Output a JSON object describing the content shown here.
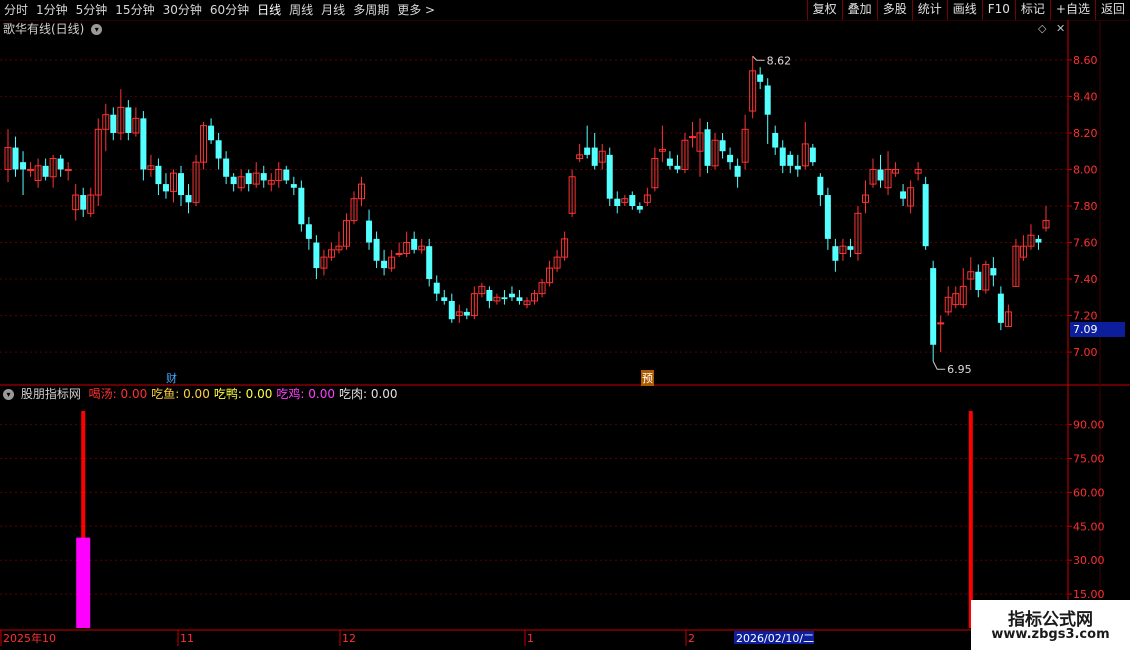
{
  "toolbar": {
    "periods": [
      "分时",
      "1分钟",
      "5分钟",
      "15分钟",
      "30分钟",
      "60分钟",
      "日线",
      "周线",
      "月线",
      "多周期"
    ],
    "active_period": "日线",
    "more_label": "更多",
    "buttons": [
      "复权",
      "叠加",
      "多股",
      "统计",
      "画线",
      "F10",
      "标记",
      "+自选",
      "返回"
    ]
  },
  "main_panel": {
    "title": "歌华有线(日线)",
    "annotations": [
      {
        "label": "财",
        "color": "#44aaff"
      },
      {
        "label": "预",
        "color": "#ffffff",
        "bg": "#b05a00"
      }
    ],
    "current_price_label": "7.09",
    "colors": {
      "up": "#ff3333",
      "down": "#54ffff",
      "grid": "#5a0000",
      "axis": "#cc0000"
    }
  },
  "indicator_panel": {
    "title": "股朋指标网",
    "legend": [
      {
        "name": "喝汤",
        "value": "0.00",
        "color": "#ff3030"
      },
      {
        "name": "吃鱼",
        "value": "0.00",
        "color": "#ffd040"
      },
      {
        "name": "吃鸭",
        "value": "0.00",
        "color": "#ffff40"
      },
      {
        "name": "吃鸡",
        "value": "0.00",
        "color": "#ff40ff"
      },
      {
        "name": "吃肉",
        "value": "0.00",
        "color": "#e0e0e0"
      }
    ]
  },
  "date_axis": {
    "labels": [
      "2025年10",
      "11",
      "12",
      "1",
      "2"
    ],
    "cursor_date": "2026/02/10/二"
  },
  "watermark": {
    "title": "指标公式网",
    "url": "www.zbgs3.com"
  },
  "chart_data": [
    {
      "type": "candlestick",
      "title": "歌华有线(日线)",
      "ylim": [
        6.88,
        8.72
      ],
      "yticks": [
        7.0,
        7.2,
        7.4,
        7.6,
        7.8,
        8.0,
        8.2,
        8.4,
        8.6
      ],
      "annotations": {
        "high": 8.62,
        "low": 6.95
      },
      "candles": [
        [
          8.0,
          8.12,
          8.22,
          7.93
        ],
        [
          8.12,
          8.0,
          8.18,
          7.96
        ],
        [
          8.04,
          8.0,
          8.1,
          7.86
        ],
        [
          8.0,
          8.0,
          8.04,
          7.96
        ],
        [
          7.94,
          8.02,
          8.06,
          7.9
        ],
        [
          8.02,
          7.96,
          8.06,
          7.94
        ],
        [
          7.96,
          8.06,
          8.08,
          7.9
        ],
        [
          8.06,
          8.0,
          8.08,
          7.96
        ],
        [
          8.0,
          8.0,
          8.04,
          7.94
        ],
        [
          7.78,
          7.86,
          7.92,
          7.72
        ],
        [
          7.86,
          7.78,
          7.9,
          7.74
        ],
        [
          7.76,
          7.86,
          7.9,
          7.74
        ],
        [
          7.86,
          8.22,
          8.28,
          7.8
        ],
        [
          8.22,
          8.3,
          8.36,
          8.1
        ],
        [
          8.3,
          8.2,
          8.34,
          8.16
        ],
        [
          8.2,
          8.34,
          8.44,
          8.16
        ],
        [
          8.34,
          8.2,
          8.38,
          8.16
        ],
        [
          8.2,
          8.28,
          8.34,
          8.18
        ],
        [
          8.28,
          8.0,
          8.32,
          7.94
        ],
        [
          8.0,
          8.02,
          8.08,
          7.96
        ],
        [
          8.02,
          7.92,
          8.06,
          7.86
        ],
        [
          7.92,
          7.88,
          7.98,
          7.84
        ],
        [
          7.88,
          7.98,
          8.0,
          7.82
        ],
        [
          7.98,
          7.86,
          8.02,
          7.8
        ],
        [
          7.86,
          7.82,
          7.92,
          7.76
        ],
        [
          7.82,
          8.04,
          8.08,
          7.8
        ],
        [
          8.04,
          8.24,
          8.26,
          8.0
        ],
        [
          8.24,
          8.16,
          8.28,
          8.14
        ],
        [
          8.16,
          8.06,
          8.2,
          8.0
        ],
        [
          8.06,
          7.96,
          8.1,
          7.92
        ],
        [
          7.96,
          7.92,
          7.98,
          7.88
        ],
        [
          7.9,
          7.96,
          8.0,
          7.88
        ],
        [
          7.98,
          7.92,
          8.0,
          7.88
        ],
        [
          7.92,
          7.98,
          8.04,
          7.9
        ],
        [
          7.98,
          7.94,
          8.02,
          7.9
        ],
        [
          7.92,
          7.94,
          7.98,
          7.88
        ],
        [
          7.94,
          8.0,
          8.04,
          7.9
        ],
        [
          8.0,
          7.94,
          8.02,
          7.92
        ],
        [
          7.92,
          7.9,
          7.96,
          7.86
        ],
        [
          7.9,
          7.7,
          7.94,
          7.66
        ],
        [
          7.7,
          7.62,
          7.74,
          7.56
        ],
        [
          7.6,
          7.46,
          7.64,
          7.4
        ],
        [
          7.46,
          7.52,
          7.56,
          7.42
        ],
        [
          7.52,
          7.56,
          7.6,
          7.5
        ],
        [
          7.56,
          7.58,
          7.66,
          7.54
        ],
        [
          7.58,
          7.72,
          7.76,
          7.56
        ],
        [
          7.72,
          7.84,
          7.88,
          7.7
        ],
        [
          7.84,
          7.92,
          7.96,
          7.8
        ],
        [
          7.72,
          7.6,
          7.78,
          7.56
        ],
        [
          7.62,
          7.5,
          7.66,
          7.46
        ],
        [
          7.5,
          7.46,
          7.56,
          7.42
        ],
        [
          7.46,
          7.52,
          7.56,
          7.44
        ],
        [
          7.54,
          7.54,
          7.6,
          7.52
        ],
        [
          7.54,
          7.6,
          7.66,
          7.52
        ],
        [
          7.62,
          7.56,
          7.66,
          7.54
        ],
        [
          7.56,
          7.58,
          7.62,
          7.54
        ],
        [
          7.58,
          7.4,
          7.62,
          7.36
        ],
        [
          7.38,
          7.32,
          7.42,
          7.28
        ],
        [
          7.3,
          7.28,
          7.34,
          7.26
        ],
        [
          7.28,
          7.18,
          7.32,
          7.16
        ],
        [
          7.2,
          7.22,
          7.26,
          7.16
        ],
        [
          7.22,
          7.2,
          7.24,
          7.18
        ],
        [
          7.2,
          7.32,
          7.36,
          7.18
        ],
        [
          7.32,
          7.36,
          7.38,
          7.3
        ],
        [
          7.34,
          7.28,
          7.36,
          7.24
        ],
        [
          7.28,
          7.3,
          7.32,
          7.26
        ],
        [
          7.3,
          7.29,
          7.34,
          7.26
        ],
        [
          7.32,
          7.3,
          7.36,
          7.28
        ],
        [
          7.3,
          7.28,
          7.34,
          7.26
        ],
        [
          7.26,
          7.28,
          7.3,
          7.24
        ],
        [
          7.28,
          7.32,
          7.34,
          7.26
        ],
        [
          7.32,
          7.38,
          7.4,
          7.3
        ],
        [
          7.38,
          7.46,
          7.5,
          7.36
        ],
        [
          7.46,
          7.52,
          7.56,
          7.44
        ],
        [
          7.52,
          7.62,
          7.66,
          7.5
        ],
        [
          7.76,
          7.96,
          8.0,
          7.74
        ],
        [
          8.06,
          8.08,
          8.14,
          8.04
        ],
        [
          8.12,
          8.08,
          8.24,
          8.06
        ],
        [
          8.12,
          8.02,
          8.2,
          8.0
        ],
        [
          8.04,
          8.1,
          8.14,
          8.0
        ],
        [
          8.08,
          7.84,
          8.12,
          7.8
        ],
        [
          7.84,
          7.8,
          7.88,
          7.76
        ],
        [
          7.82,
          7.84,
          7.86,
          7.8
        ],
        [
          7.86,
          7.8,
          7.88,
          7.78
        ],
        [
          7.8,
          7.78,
          7.82,
          7.76
        ],
        [
          7.82,
          7.86,
          7.9,
          7.8
        ],
        [
          7.9,
          8.06,
          8.12,
          7.88
        ],
        [
          8.1,
          8.11,
          8.24,
          8.04
        ],
        [
          8.06,
          8.02,
          8.1,
          8.0
        ],
        [
          8.02,
          8.0,
          8.08,
          7.98
        ],
        [
          8.0,
          8.16,
          8.2,
          7.98
        ],
        [
          8.18,
          8.18,
          8.26,
          8.12
        ],
        [
          8.1,
          8.2,
          8.28,
          7.96
        ],
        [
          8.22,
          8.02,
          8.26,
          7.98
        ],
        [
          8.02,
          8.16,
          8.2,
          8.0
        ],
        [
          8.16,
          8.1,
          8.2,
          8.06
        ],
        [
          8.08,
          8.04,
          8.12,
          8.0
        ],
        [
          8.02,
          7.96,
          8.06,
          7.9
        ],
        [
          8.04,
          8.22,
          8.3,
          8.0
        ],
        [
          8.32,
          8.54,
          8.62,
          8.28
        ],
        [
          8.52,
          8.48,
          8.56,
          8.44
        ],
        [
          8.46,
          8.3,
          8.5,
          8.14
        ],
        [
          8.2,
          8.12,
          8.24,
          8.08
        ],
        [
          8.12,
          8.02,
          8.16,
          7.98
        ],
        [
          8.08,
          8.02,
          8.1,
          7.98
        ],
        [
          8.02,
          8.0,
          8.08,
          7.96
        ],
        [
          8.02,
          8.14,
          8.26,
          8.0
        ],
        [
          8.12,
          8.04,
          8.14,
          8.02
        ],
        [
          7.96,
          7.86,
          7.98,
          7.8
        ],
        [
          7.86,
          7.62,
          7.9,
          7.56
        ],
        [
          7.58,
          7.5,
          7.62,
          7.44
        ],
        [
          7.54,
          7.58,
          7.62,
          7.5
        ],
        [
          7.58,
          7.56,
          7.62,
          7.52
        ],
        [
          7.54,
          7.76,
          7.8,
          7.5
        ],
        [
          7.82,
          7.86,
          7.94,
          7.76
        ],
        [
          7.92,
          8.0,
          8.06,
          7.9
        ],
        [
          8.0,
          7.94,
          8.08,
          7.9
        ],
        [
          7.9,
          8.0,
          8.1,
          7.86
        ],
        [
          7.98,
          8.0,
          8.04,
          7.96
        ],
        [
          7.88,
          7.84,
          7.92,
          7.8
        ],
        [
          7.8,
          7.9,
          7.94,
          7.76
        ],
        [
          7.98,
          8.0,
          8.04,
          7.94
        ],
        [
          7.92,
          7.58,
          7.96,
          7.56
        ],
        [
          7.46,
          7.04,
          7.5,
          6.95
        ],
        [
          7.16,
          7.16,
          7.2,
          7.0
        ],
        [
          7.22,
          7.3,
          7.36,
          7.2
        ],
        [
          7.26,
          7.32,
          7.36,
          7.24
        ],
        [
          7.26,
          7.36,
          7.46,
          7.24
        ],
        [
          7.4,
          7.44,
          7.52,
          7.34
        ],
        [
          7.44,
          7.34,
          7.48,
          7.3
        ],
        [
          7.34,
          7.48,
          7.5,
          7.32
        ],
        [
          7.46,
          7.42,
          7.52,
          7.36
        ],
        [
          7.32,
          7.16,
          7.36,
          7.12
        ],
        [
          7.14,
          7.22,
          7.26,
          7.14
        ],
        [
          7.36,
          7.58,
          7.62,
          7.36
        ],
        [
          7.52,
          7.58,
          7.64,
          7.5
        ],
        [
          7.58,
          7.64,
          7.7,
          7.56
        ],
        [
          7.62,
          7.6,
          7.64,
          7.56
        ],
        [
          7.68,
          7.72,
          7.8,
          7.66
        ]
      ]
    },
    {
      "type": "bar",
      "title": "股朋指标网",
      "ylim": [
        0,
        100
      ],
      "yticks": [
        15.0,
        30.0,
        45.0,
        60.0,
        75.0,
        90.0
      ],
      "bars": [
        {
          "series": "喝汤",
          "index": 10,
          "value": 96,
          "color": "#ff0000",
          "style": "line"
        },
        {
          "series": "吃鸡",
          "index": 10,
          "value": 40,
          "color": "#ff00ff",
          "style": "block"
        },
        {
          "series": "喝汤",
          "index": 128,
          "value": 96,
          "color": "#ff0000",
          "style": "line"
        }
      ]
    }
  ]
}
